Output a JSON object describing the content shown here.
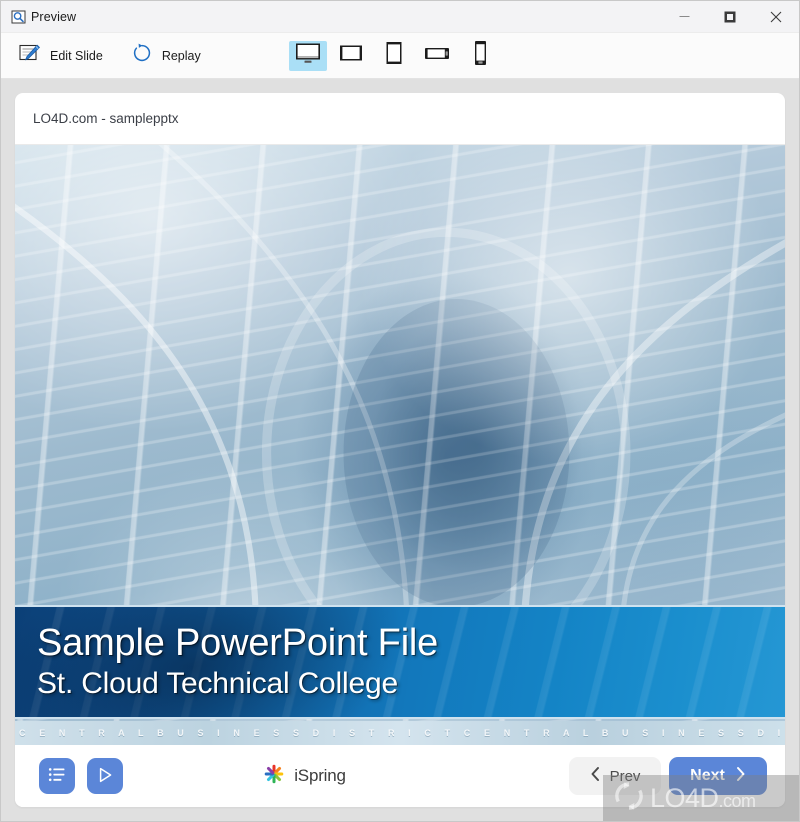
{
  "window": {
    "title": "Preview",
    "app_icon": "magnifier-icon",
    "controls": {
      "minimize": "minimize-icon",
      "maximize": "maximize-icon",
      "close": "close-icon"
    }
  },
  "toolbar": {
    "edit_slide_label": "Edit Slide",
    "edit_slide_icon": "edit-slide-pencil-icon",
    "replay_label": "Replay",
    "replay_icon": "replay-circular-arrow-icon",
    "devices": [
      {
        "name": "desktop",
        "icon": "desktop-monitor-icon",
        "selected": true
      },
      {
        "name": "tablet-landscape",
        "icon": "tablet-landscape-icon",
        "selected": false
      },
      {
        "name": "tablet-portrait",
        "icon": "tablet-portrait-icon",
        "selected": false
      },
      {
        "name": "phone-landscape",
        "icon": "phone-landscape-icon",
        "selected": false
      },
      {
        "name": "phone-portrait",
        "icon": "phone-portrait-icon",
        "selected": false
      }
    ],
    "active_device_highlight": "#aadff6"
  },
  "card": {
    "title": "LO4D.com - samplepptx"
  },
  "slide": {
    "title": "Sample PowerPoint File",
    "subtitle": "St. Cloud Technical College",
    "footer_strip_text": "C E N T R A L  B U S I N E S S  D I S T R I C T  C E N T R A L  B U S I N E S S  D I S T R I C T  C E N T R A",
    "band_color": "#1278bc",
    "background_description": "abstract blue glass office building facade"
  },
  "player": {
    "outline_button_icon": "outline-list-icon",
    "play_button_icon": "play-triangle-icon",
    "button_color": "#5b86d8",
    "brand_name": "iSpring",
    "brand_icon": "ispring-pinwheel-logo",
    "prev_label": "Prev",
    "prev_icon": "chevron-left-icon",
    "next_label": "Next",
    "next_icon": "chevron-right-icon",
    "next_color": "#5b86d8"
  },
  "watermark": {
    "text": "LO4D",
    "suffix": ".com",
    "icon": "circular-arrows-icon"
  }
}
